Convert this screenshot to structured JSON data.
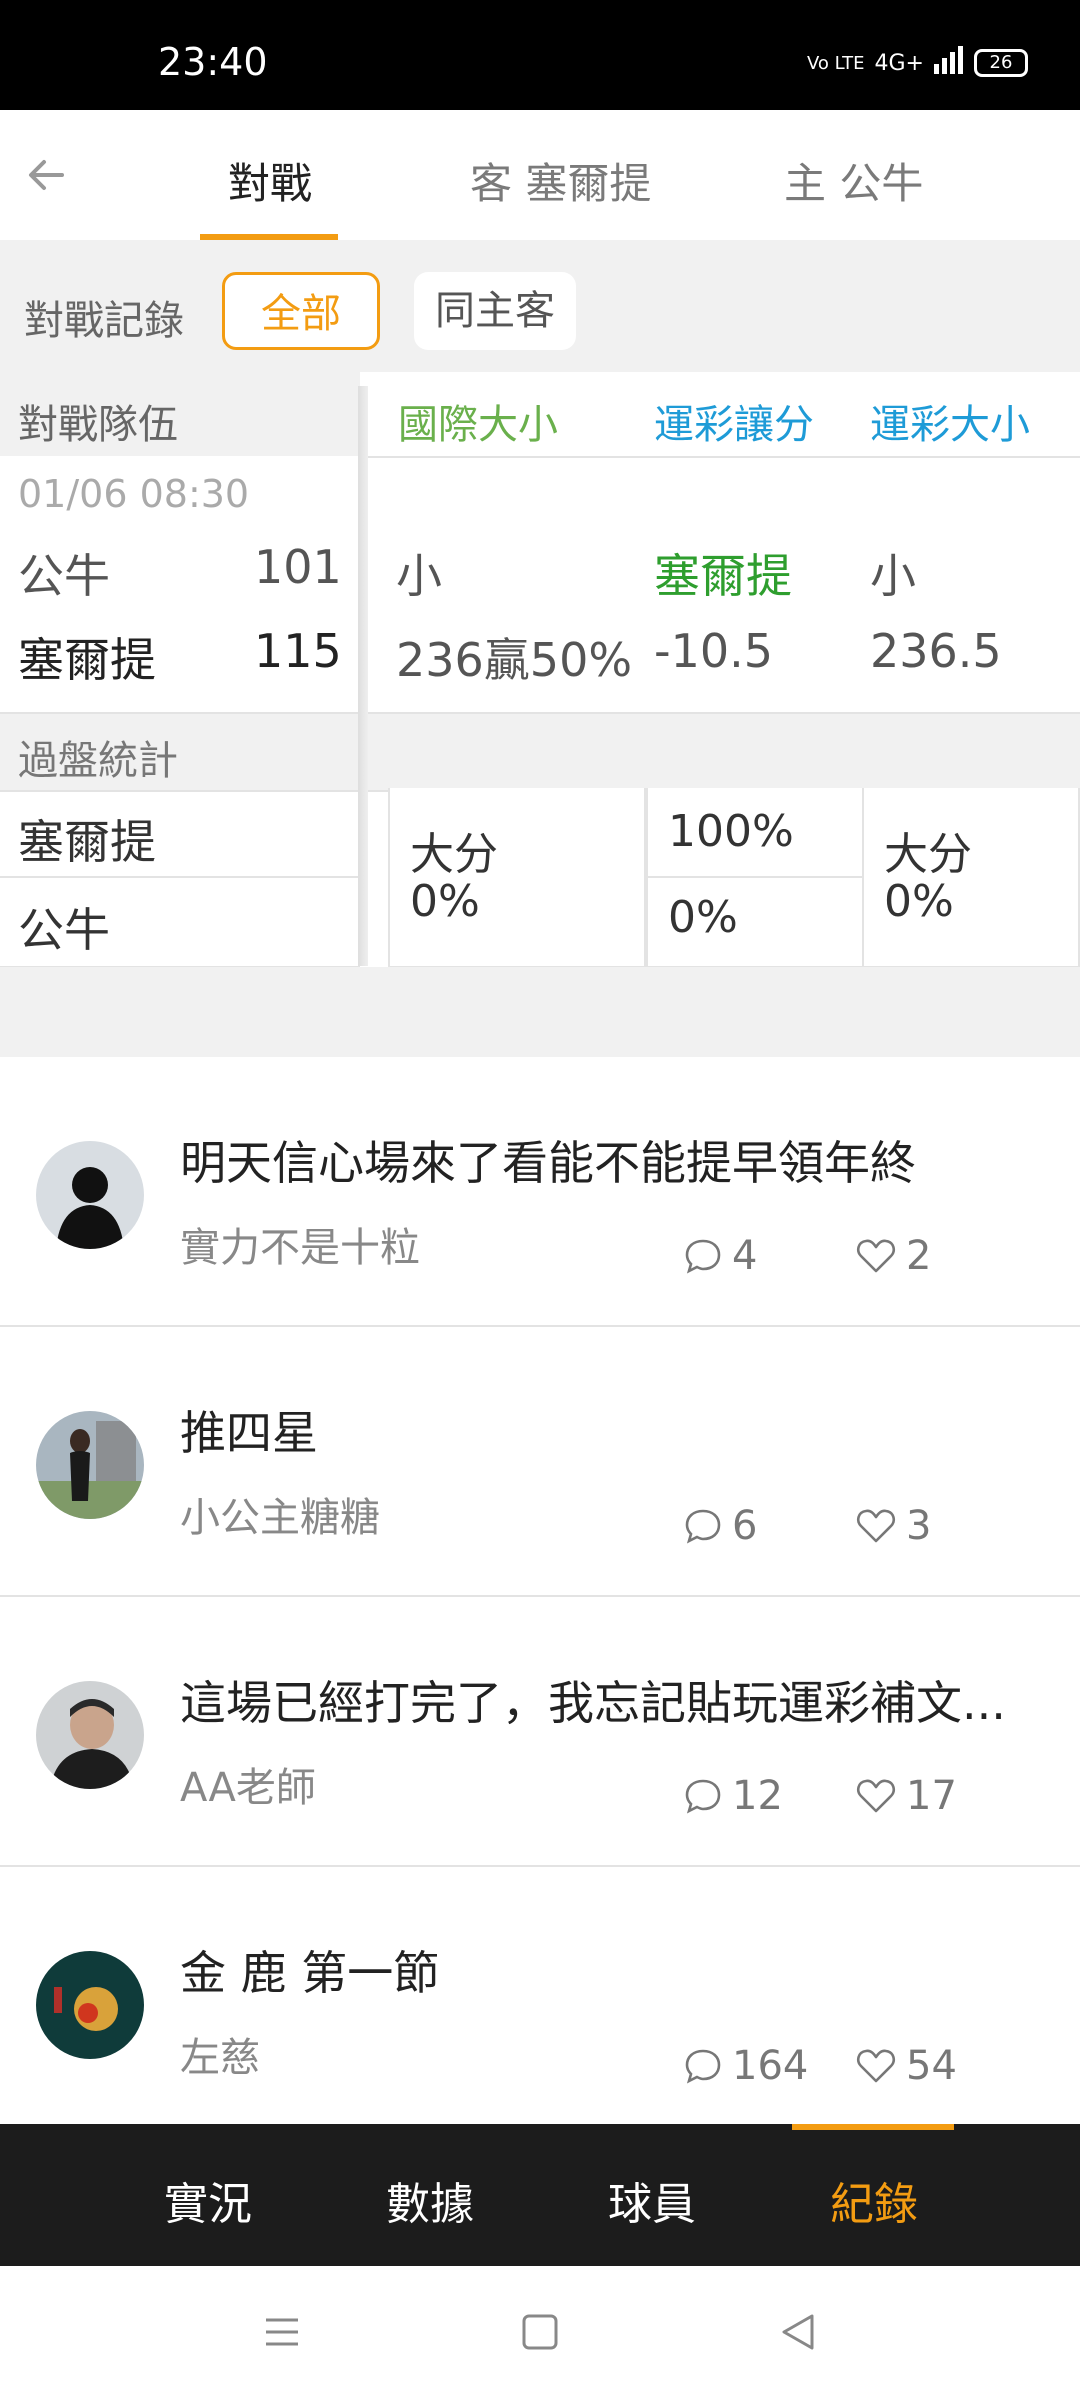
{
  "status_bar": {
    "time": "23:40",
    "network": "4G+",
    "battery": "26",
    "volte": "Vo LTE"
  },
  "header": {
    "tabs": [
      {
        "label": "對戰",
        "active": true
      },
      {
        "label": "客 塞爾提",
        "active": false
      },
      {
        "label": "主 公牛",
        "active": false
      }
    ]
  },
  "filter": {
    "label": "對戰記錄",
    "options": [
      "全部",
      "同主客"
    ],
    "selected": "全部"
  },
  "table": {
    "headers": {
      "team": "對戰隊伍",
      "intl_ou": "國際大小",
      "spread": "運彩讓分",
      "ou": "運彩大小"
    },
    "header_colors": {
      "intl_ou": "#6ab04c",
      "spread": "#1e9bd7",
      "ou": "#1e9bd7"
    },
    "match": {
      "date": "01/06 08:30",
      "rows": [
        {
          "team": "公牛",
          "score": "101",
          "intl_ou": "小",
          "spread": "塞爾提",
          "ou": "小"
        },
        {
          "team": "塞爾提",
          "score": "115",
          "intl_ou": "236贏50%",
          "spread": "-10.5",
          "ou": "236.5"
        }
      ],
      "spread_color": "#2e9e2e"
    },
    "stats": {
      "title": "過盤統計",
      "teams": [
        "塞爾提",
        "公牛"
      ],
      "intl_ou": {
        "line1": "大分",
        "line2": "0%"
      },
      "spread": {
        "top": "100%",
        "bottom": "0%"
      },
      "ou": {
        "line1": "大分",
        "line2": "0%"
      }
    }
  },
  "posts": [
    {
      "title": "明天信心場來了看能不能提早領年終",
      "author": "實力不是十粒",
      "comments": "4",
      "likes": "2"
    },
    {
      "title": "推四星",
      "author": "小公主糖糖",
      "comments": "6",
      "likes": "3"
    },
    {
      "title": "這場已經打完了，我忘記貼玩運彩補文...",
      "author": "AA老師",
      "comments": "12",
      "likes": "17"
    },
    {
      "title": "金 鹿 第一節",
      "author": "左慈",
      "comments": "164",
      "likes": "54"
    }
  ],
  "bottom_nav": {
    "items": [
      "實況",
      "數據",
      "球員",
      "紀錄"
    ],
    "active": "紀錄",
    "accent": "#f39c12"
  }
}
